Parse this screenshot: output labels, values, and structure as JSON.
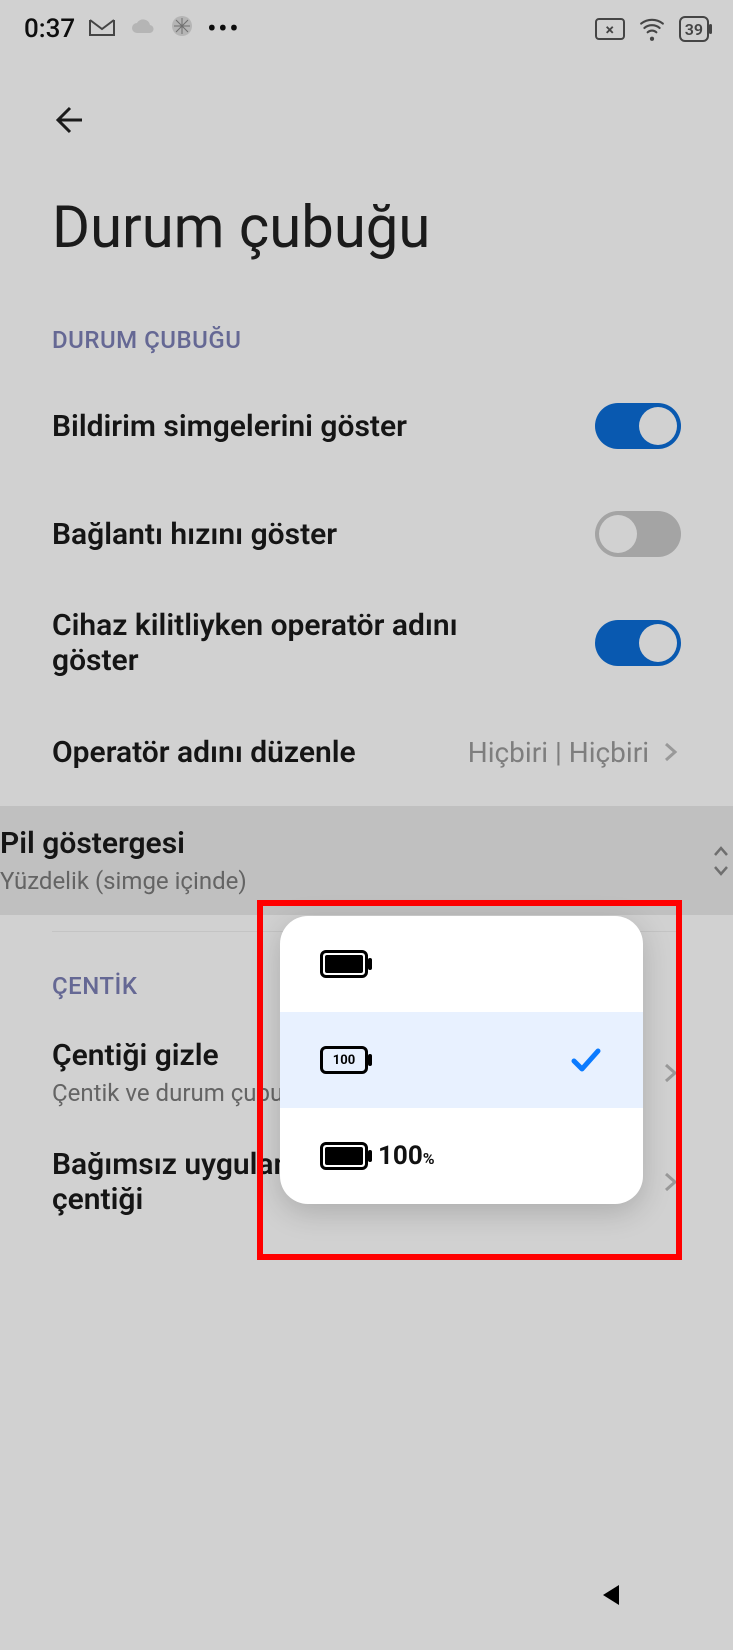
{
  "status": {
    "time": "0:37",
    "battery_level": "39"
  },
  "page": {
    "title": "Durum çubuğu"
  },
  "section1": {
    "label": "DURUM ÇUBUĞU",
    "rows": {
      "show_icons": {
        "label": "Bildirim simgelerini göster",
        "on": true
      },
      "connection_speed": {
        "label": "Bağlantı hızını göster",
        "on": false
      },
      "carrier_locked": {
        "label": "Cihaz kilitliyken operatör adını göster",
        "on": true
      },
      "edit_carrier": {
        "label": "Operatör adını düzenle",
        "value": "Hiçbiri | Hiçbiri"
      },
      "battery_indicator": {
        "label": "Pil göstergesi",
        "sub": "Yüzdelik (simge içinde)"
      }
    }
  },
  "section2": {
    "label": "ÇENTİK",
    "rows": {
      "hide_notch": {
        "label": "Çentiği gizle",
        "sub": "Çentik ve durum çubu"
      },
      "independent_apps": {
        "label": "Bağımsız uygulamalarda ekran çentiği"
      }
    }
  },
  "popup": {
    "option_inside_text": "100",
    "option_outside_text": "100",
    "option_outside_pct": "%"
  }
}
